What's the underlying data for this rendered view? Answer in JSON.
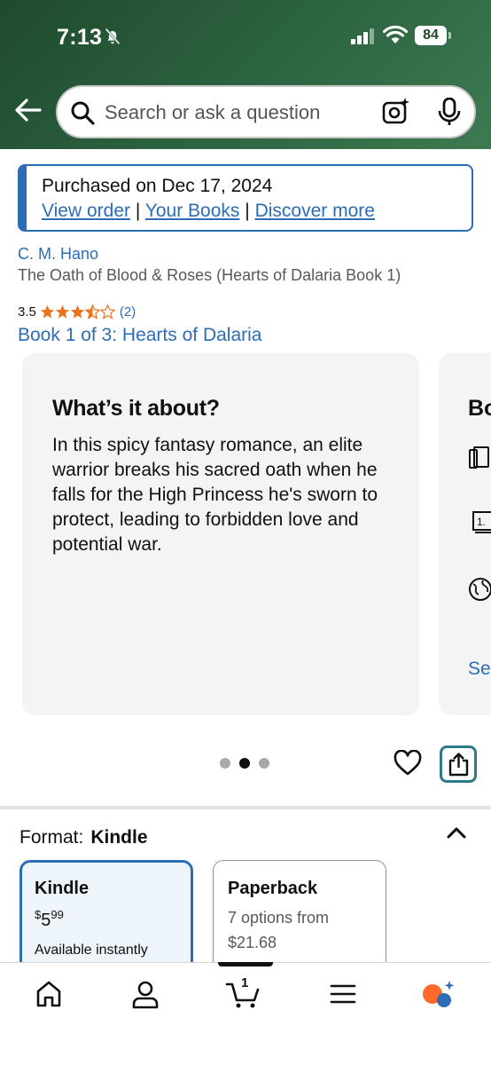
{
  "status_bar": {
    "time": "7:13",
    "battery": "84"
  },
  "search": {
    "placeholder": "Search or ask a question"
  },
  "purchase": {
    "text": "Purchased on Dec 17, 2024",
    "link_view_order": "View order",
    "link_your_books": "Your Books",
    "link_discover": "Discover more",
    "separator": "|"
  },
  "book": {
    "author": "C. M. Hano",
    "title": "The Oath of Blood & Roses (Hearts of Dalaria Book 1)",
    "rating": "3.5",
    "rating_stars": 3.5,
    "rating_count": "(2)",
    "series": "Book 1 of 3: Hearts of Dalaria"
  },
  "about_card": {
    "title": "What’s it about?",
    "body": "In this spicy fantasy romance, an elite warrior breaks his sacred oath when he falls for the High Princess he's sworn to protect, leading to forbidden love and potential war."
  },
  "second_card": {
    "title_partial": "Bo",
    "link_partial": "Se"
  },
  "carousel": {
    "total": 3,
    "active": 2
  },
  "format": {
    "label": "Format:",
    "value": "Kindle",
    "options": [
      {
        "name": "Kindle",
        "price_dollars": "5",
        "price_cents": "99",
        "currency": "$",
        "note": "Available instantly"
      },
      {
        "name": "Paperback",
        "line1": "7 options from",
        "line2": "$21.68"
      }
    ]
  },
  "bottom_nav": {
    "items": [
      "home-icon",
      "account-icon",
      "cart-icon",
      "menu-icon",
      "rufus-icon"
    ],
    "cart_count": "1"
  },
  "colors": {
    "header_green": "#2d6540",
    "link_blue": "#2c6db5",
    "star_orange": "#e8741f",
    "rufus_orange": "#ff6a2c"
  }
}
